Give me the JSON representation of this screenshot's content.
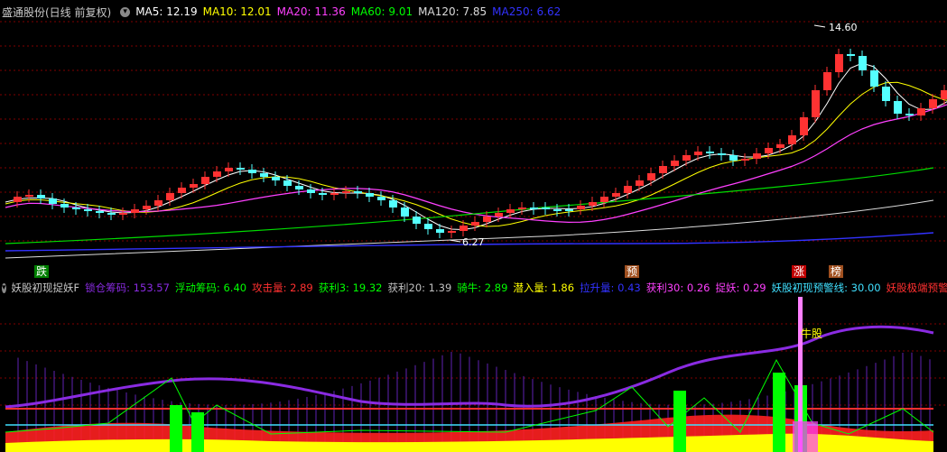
{
  "main_header": {
    "title": "盛通股份(日线 前复权)",
    "items": [
      {
        "label": "MA5: 12.19",
        "color": "#ffffff"
      },
      {
        "label": "MA10: 12.01",
        "color": "#ffff00"
      },
      {
        "label": "MA20: 11.36",
        "color": "#ff40ff"
      },
      {
        "label": "MA60: 9.01",
        "color": "#00ff00"
      },
      {
        "label": "MA120: 7.85",
        "color": "#dcdcdc"
      },
      {
        "label": "MA250: 6.62",
        "color": "#3232ff"
      }
    ]
  },
  "price_labels": {
    "high": "14.60",
    "low": "6.27"
  },
  "signals": [
    {
      "text": "跌",
      "bg": "#008000",
      "fg": "#ffffff"
    },
    {
      "text": "预",
      "bg": "#a05020",
      "fg": "#ffffff"
    },
    {
      "text": "涨",
      "bg": "#c00000",
      "fg": "#ffffff"
    },
    {
      "text": "榜",
      "bg": "#a05020",
      "fg": "#ffffff"
    }
  ],
  "indicator_header": {
    "title": "妖股初现捉妖F",
    "items": [
      {
        "label": "锁仓筹码: 153.57",
        "color": "#8a2be2"
      },
      {
        "label": "浮动筹码: 6.40",
        "color": "#00ff00"
      },
      {
        "label": "攻击量: 2.89",
        "color": "#ff3030"
      },
      {
        "label": "获利3: 19.32",
        "color": "#00ff00"
      },
      {
        "label": "获利20: 1.39",
        "color": "#c0c0c0"
      },
      {
        "label": "骑牛: 2.89",
        "color": "#00ff00"
      },
      {
        "label": "潜入量: 1.86",
        "color": "#ffff00"
      },
      {
        "label": "拉升量: 0.43",
        "color": "#3232ff"
      },
      {
        "label": "获利30: 0.26",
        "color": "#ff40ff"
      },
      {
        "label": "捉妖: 0.29",
        "color": "#ff40ff"
      },
      {
        "label": "妖股初现预警线: 30.00",
        "color": "#40e0ff"
      },
      {
        "label": "妖股极端预警线",
        "color": "#ff3030"
      }
    ]
  },
  "indicator_label": "牛股",
  "colors": {
    "up": "#ff3232",
    "down": "#54ffff",
    "grid": "#800000"
  }
}
